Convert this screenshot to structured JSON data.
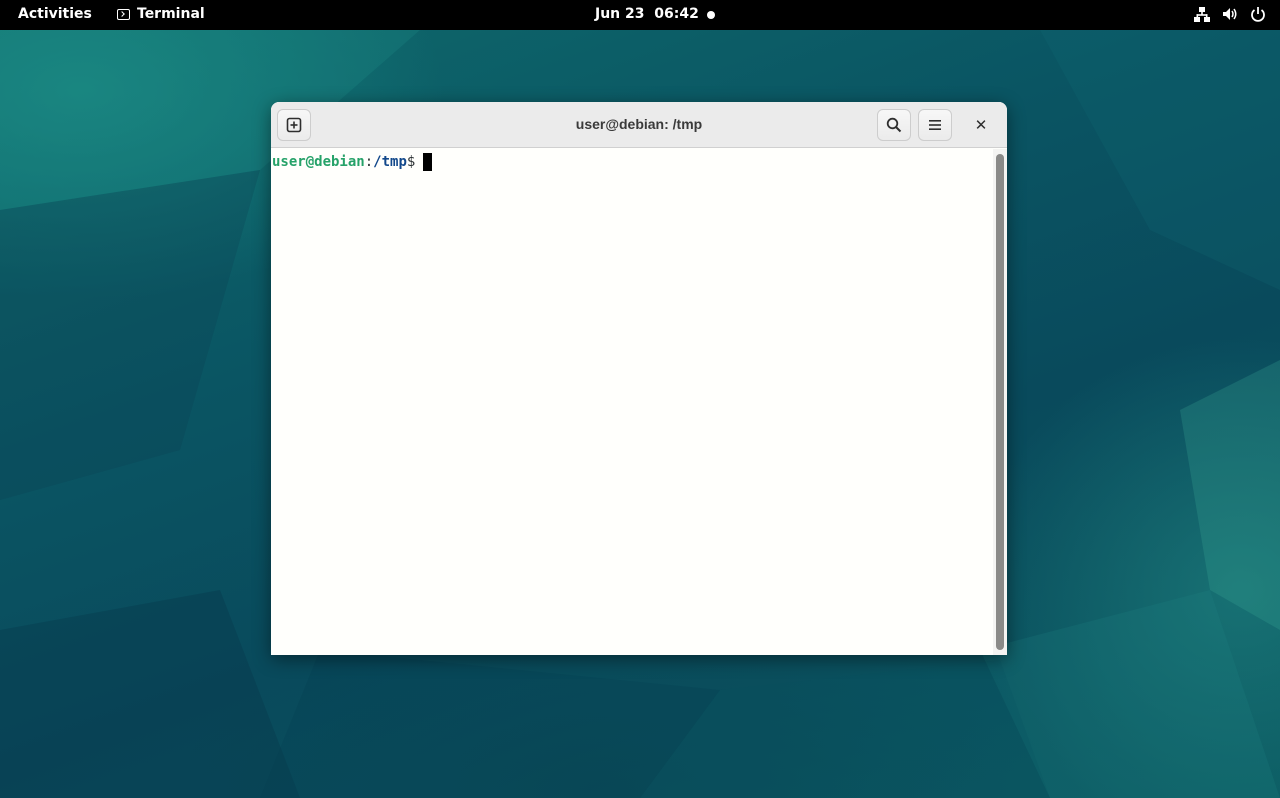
{
  "topbar": {
    "activities_label": "Activities",
    "app_name": "Terminal",
    "clock": "Jun 23  06:42",
    "tray_icons": [
      "network-icon",
      "volume-icon",
      "power-icon"
    ]
  },
  "window": {
    "title": "user@debian: /tmp",
    "prompt": {
      "user_host": "user@debian",
      "colon": ":",
      "path": "/tmp",
      "symbol": "$"
    }
  },
  "colors": {
    "prompt_user": "#26a269",
    "prompt_path": "#12488b",
    "topbar": "#000000",
    "terminal_bg": "#fffffc"
  }
}
